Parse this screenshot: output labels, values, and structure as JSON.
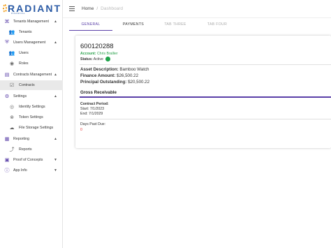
{
  "brand": {
    "name": "RADIANT",
    "tagline": "FINANCIAL"
  },
  "sidebar": {
    "items": [
      {
        "label": "Tenants Management",
        "icon": "tenants-icon",
        "expanded": true
      },
      {
        "label": "Tenants",
        "icon": "people-icon"
      },
      {
        "label": "Users Management",
        "icon": "shield-icon",
        "expanded": true
      },
      {
        "label": "Users",
        "icon": "user-icon"
      },
      {
        "label": "Roles",
        "icon": "circle-user-icon"
      },
      {
        "label": "Contracts Management",
        "icon": "contracts-icon",
        "expanded": true
      },
      {
        "label": "Contracts",
        "icon": "contract-doc-icon",
        "active": true
      },
      {
        "label": "Settings",
        "icon": "gear-icon",
        "expanded": true
      },
      {
        "label": "Identity Settings",
        "icon": "fingerprint-icon"
      },
      {
        "label": "Token Settings",
        "icon": "token-icon"
      },
      {
        "label": "File Storage Settings",
        "icon": "cloud-icon"
      },
      {
        "label": "Reporting",
        "icon": "reporting-icon",
        "expanded": true
      },
      {
        "label": "Reports",
        "icon": "chart-line-icon"
      },
      {
        "label": "Proof of Concepts",
        "icon": "proof-icon",
        "expanded": false
      },
      {
        "label": "App Info",
        "icon": "info-icon",
        "expanded": false
      }
    ]
  },
  "topbar": {
    "home": "Home",
    "separator": "/",
    "current": "Dashboard"
  },
  "tabs": [
    {
      "label": "GENERAL",
      "active": true
    },
    {
      "label": "PAYMENTS"
    },
    {
      "label": "TAB THREE",
      "disabled": true
    },
    {
      "label": "TAB FOUR",
      "disabled": true
    }
  ],
  "contract": {
    "number": "600120288",
    "account_label": "Account:",
    "account_value": "Chris Brallier",
    "status_label": "Status:",
    "status_value": "Active",
    "asset_label": "Asset Description:",
    "asset_value": "Bamboo Watch",
    "finance_label": "Finance Amount:",
    "finance_value": "$26,500.22",
    "principal_label": "Principal Outstanding:",
    "principal_value": "$20,500.22",
    "section_title": "Gross Receivable",
    "period_label": "Contract Period:",
    "start_label": "Start:",
    "start_value": "7/1/2023",
    "end_label": "End:",
    "end_value": "7/1/2029",
    "dpd_label": "Days Past Due:",
    "dpd_value": "0"
  },
  "colors": {
    "accent": "#5a3fa8",
    "active_green": "#1fa34a",
    "alert_red": "#e53935",
    "brand_blue": "#2a5aa5"
  }
}
